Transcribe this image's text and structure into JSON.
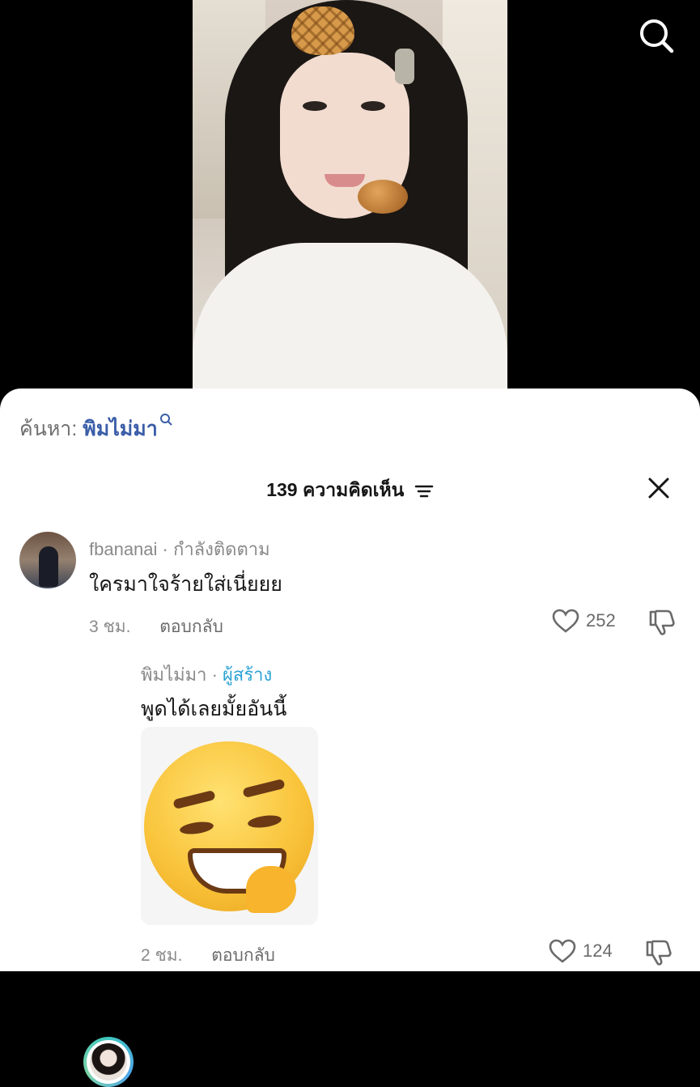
{
  "search": {
    "prefix": "ค้นหา:",
    "term": "พิมไม่มา"
  },
  "comments_header": {
    "count": "139",
    "label": "ความคิดเห็น"
  },
  "comments": [
    {
      "username": "fbananai",
      "status": "กำลังติดตาม",
      "text": "ใครมาใจร้ายใส่เนี่ยยย",
      "time": "3 ชม.",
      "reply_label": "ตอบกลับ",
      "likes": "252"
    },
    {
      "username": "พิมไม่มา",
      "status": "ผู้สร้าง",
      "text": "พูดได้เลยมั้ยอันนี้",
      "time": "2 ชม.",
      "reply_label": "ตอบกลับ",
      "likes": "124",
      "sticker": "smirking-face-emoji"
    }
  ],
  "icons": {
    "search": "search-icon",
    "filter": "filter-icon",
    "close": "close-icon",
    "like": "heart-icon",
    "dislike": "thumbs-down-icon"
  },
  "colors": {
    "link_blue": "#3a5da8",
    "creator_badge": "#2ea3d6",
    "text_primary": "#161616",
    "text_secondary": "#8a8a8a"
  }
}
